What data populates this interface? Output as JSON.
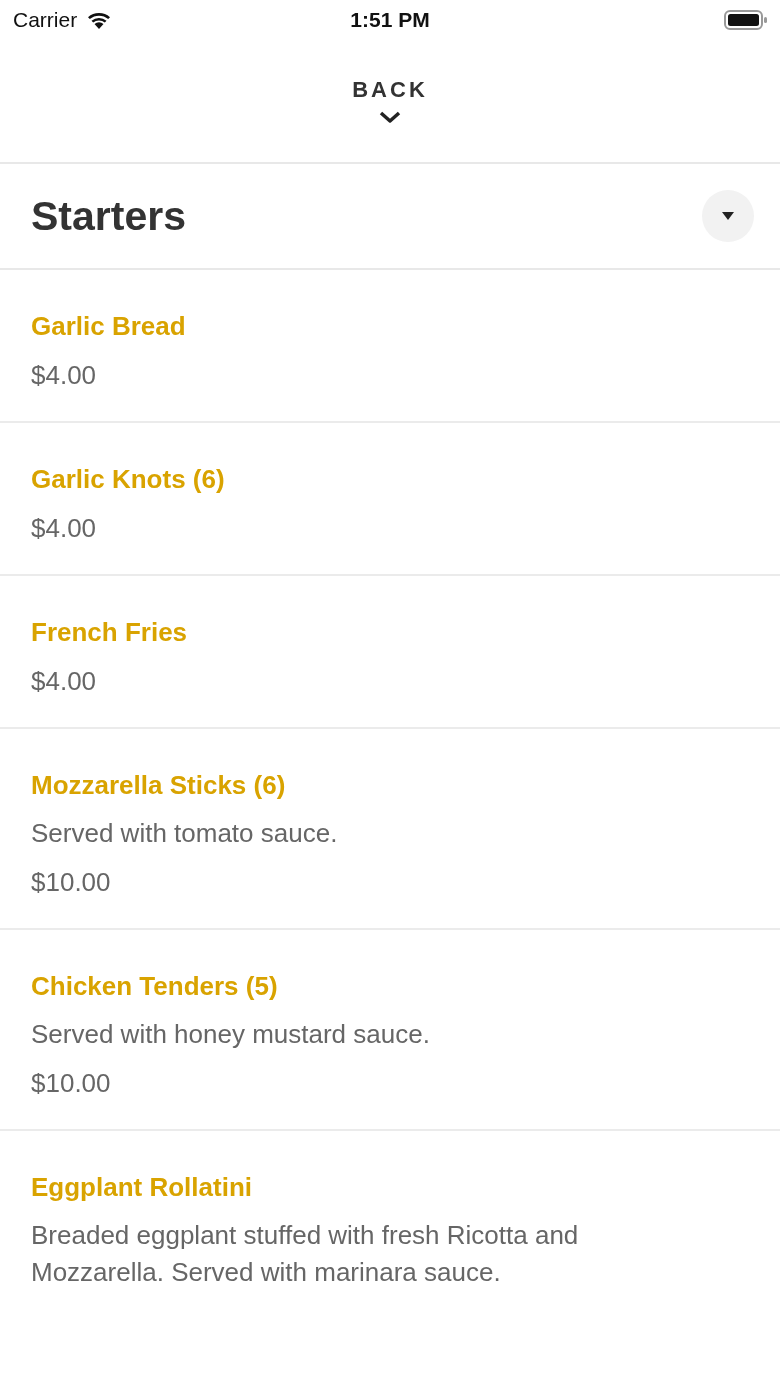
{
  "status_bar": {
    "carrier": "Carrier",
    "time": "1:51 PM"
  },
  "header": {
    "back_label": "BACK"
  },
  "section": {
    "title": "Starters"
  },
  "items": [
    {
      "name": "Garlic Bread",
      "price": "$4.00"
    },
    {
      "name": "Garlic Knots (6)",
      "price": "$4.00"
    },
    {
      "name": "French Fries",
      "price": "$4.00"
    },
    {
      "name": "Mozzarella Sticks (6)",
      "description": "Served with tomato sauce.",
      "price": "$10.00"
    },
    {
      "name": "Chicken Tenders (5)",
      "description": "Served with honey mustard sauce.",
      "price": "$10.00"
    },
    {
      "name": "Eggplant Rollatini",
      "description": "Breaded eggplant stuffed with fresh Ricotta and Mozzarella. Served with marinara sauce."
    }
  ]
}
